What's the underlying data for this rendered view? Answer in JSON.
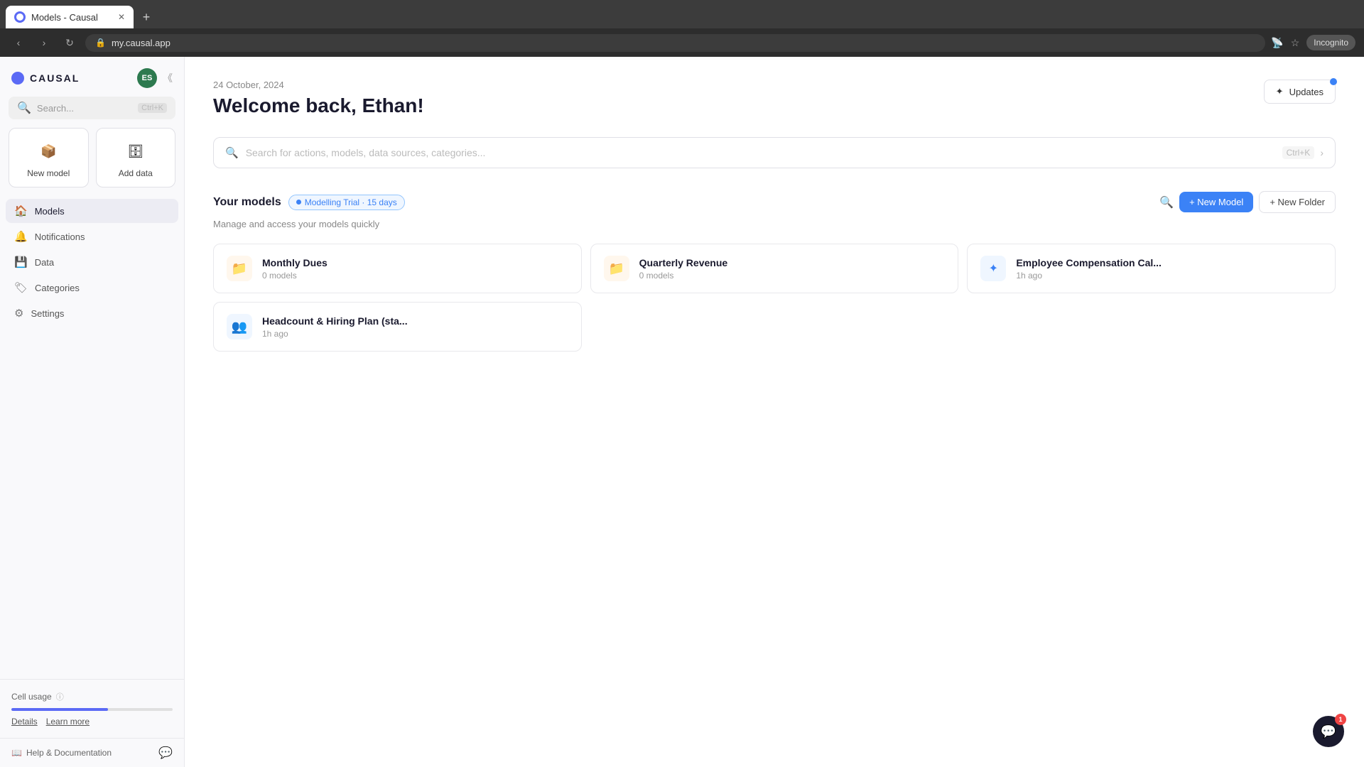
{
  "browser": {
    "tab_title": "Models - Causal",
    "address": "my.causal.app",
    "incognito_label": "Incognito"
  },
  "sidebar": {
    "logo_text": "CAUSAL",
    "avatar_initials": "ES",
    "search_placeholder": "Search...",
    "search_shortcut": "Ctrl+K",
    "quick_actions": [
      {
        "label": "New model",
        "icon": "📦"
      },
      {
        "label": "Add data",
        "icon": "🗄"
      }
    ],
    "nav_items": [
      {
        "label": "Models",
        "icon": "🏠",
        "active": true
      },
      {
        "label": "Notifications",
        "icon": "🔔",
        "active": false
      },
      {
        "label": "Data",
        "icon": "💾",
        "active": false
      },
      {
        "label": "Categories",
        "icon": "🏷",
        "active": false
      },
      {
        "label": "Settings",
        "icon": "⚙",
        "active": false
      }
    ],
    "cell_usage_label": "Cell usage",
    "cell_usage_progress": 60,
    "cell_usage_links": [
      "Details",
      "Learn more"
    ],
    "help_label": "Help & Documentation"
  },
  "main": {
    "date": "24 October, 2024",
    "title": "Welcome back, Ethan!",
    "updates_label": "Updates",
    "search_placeholder": "Search for actions, models, data sources, categories...",
    "search_shortcut": "Ctrl+K",
    "models_section": {
      "title": "Your models",
      "trial_badge": "Modelling Trial · 15 days",
      "subtitle": "Manage and access your models quickly",
      "new_model_btn": "+ New Model",
      "new_folder_btn": "+ New Folder",
      "models": [
        {
          "name": "Monthly Dues",
          "meta": "0 models",
          "type": "folder",
          "icon": "📁"
        },
        {
          "name": "Quarterly Revenue",
          "meta": "0 models",
          "type": "folder",
          "icon": "📁"
        },
        {
          "name": "Employee Compensation Cal...",
          "meta": "1h ago",
          "type": "model",
          "icon": "✦"
        },
        {
          "name": "Headcount & Hiring Plan (sta...",
          "meta": "1h ago",
          "type": "model",
          "icon": "👥"
        }
      ]
    }
  },
  "chat_bubble": {
    "badge": "1"
  }
}
